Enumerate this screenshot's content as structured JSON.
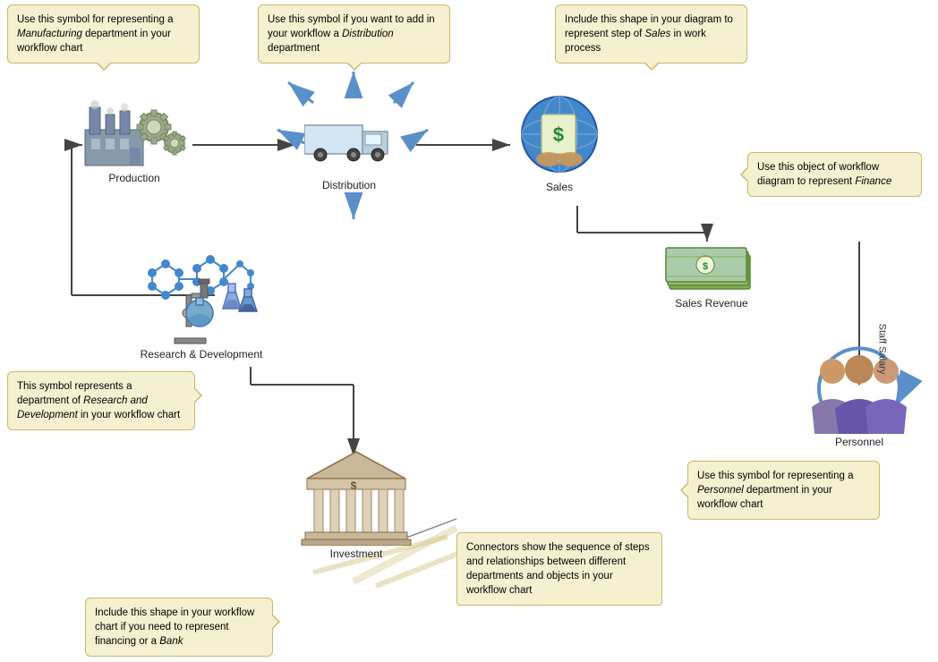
{
  "callouts": {
    "manufacturing": "Use this symbol for representing a <em>Manufacturing</em> department in your workflow chart",
    "distribution": "Use this symbol if you want to add in your workflow a <em>Distribution</em> department",
    "sales": "Include this shape in your diagram to represent step of <em>Sales</em> in work process",
    "finance": "Use this object of workflow diagram to represent <em>Finance</em>",
    "research": "This symbol represents a department of <em>Research and Development</em> in your workflow chart",
    "personnel": "Use this symbol for representing a <em>Personnel</em> department in your workflow chart",
    "bank": "Include this shape in your workflow chart if you need to represent financing or a <em>Bank</em>",
    "connectors": "Connectors show the sequence of steps and relationships between different departments and objects in your workflow chart"
  },
  "labels": {
    "production": "Production",
    "distribution": "Distribution",
    "sales": "Sales",
    "salesRevenue": "Sales Revenue",
    "research": "Research & Development",
    "investment": "Investment",
    "personnel": "Personnel",
    "staffSalary": "Staff Salary"
  },
  "colors": {
    "calloutBg": "#f5f0d0",
    "calloutBorder": "#c8b86e",
    "arrowColor": "#5b8fc9",
    "lineColor": "#555"
  }
}
